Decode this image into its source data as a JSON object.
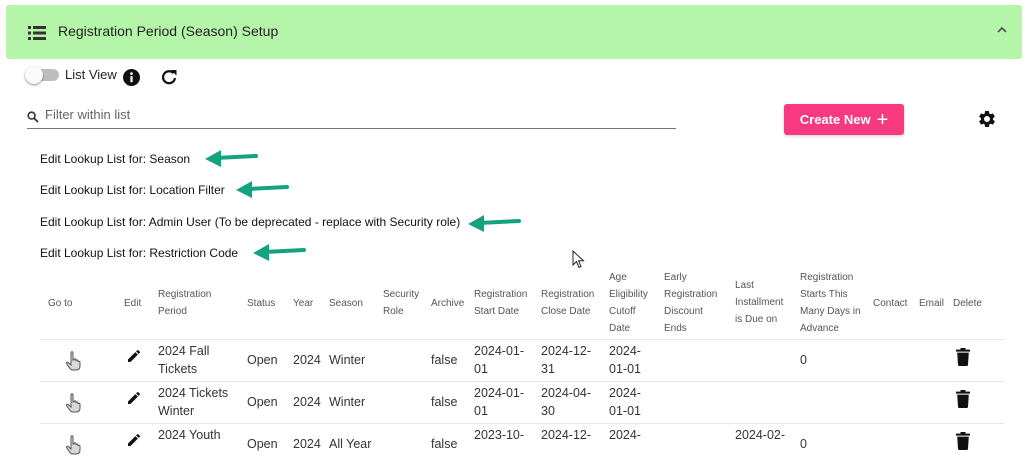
{
  "header": {
    "title": "Registration Period (Season) Setup"
  },
  "toolbar": {
    "list_view_label": "List View"
  },
  "filter": {
    "placeholder": "Filter within list"
  },
  "create_button": {
    "label": "Create New"
  },
  "lookups": [
    "Edit Lookup List for: Season",
    "Edit Lookup List for: Location Filter",
    "Edit Lookup List for: Admin User (To be deprecated - replace with Security role)",
    "Edit Lookup List for: Restriction Code"
  ],
  "colors": {
    "header_bg": "#b5f5a9",
    "create_button": "#f7397f",
    "arrow": "#14a37f"
  },
  "table": {
    "columns": [
      "Go to",
      "Edit",
      "Registration Period",
      "Status",
      "Year",
      "Season",
      "Security Role",
      "Archive",
      "Registration Start Date",
      "Registration Close Date",
      "Age Eligibility Cutoff Date",
      "Early Registration Discount Ends",
      "Last Installment is Due on",
      "Registration Starts This Many Days in Advance",
      "Contact",
      "Email",
      "Delete"
    ],
    "rows": [
      {
        "period": "2024 Fall Tickets",
        "status": "Open",
        "year": "2024",
        "season": "Winter",
        "archive": "false",
        "start": "2024-01-01",
        "close": "2024-12-31",
        "cutoff": "2024-01-01",
        "installment": "",
        "days": "0"
      },
      {
        "period": "2024 Tickets Winter",
        "status": "Open",
        "year": "2024",
        "season": "Winter",
        "archive": "false",
        "start": "2024-01-01",
        "close": "2024-04-30",
        "cutoff": "2024-01-01",
        "installment": "",
        "days": ""
      },
      {
        "period": "2024 Youth",
        "status": "Open",
        "year": "2024",
        "season": "All Year",
        "archive": "false",
        "start": "2023-10-",
        "close": "2024-12-",
        "cutoff": "2024-",
        "installment": "2024-02-",
        "days": "0"
      }
    ]
  },
  "icons": {
    "header": "list-icon",
    "collapse": "chevron-up-icon",
    "info": "info-icon",
    "refresh": "refresh-icon",
    "search": "search-icon",
    "settings": "gear-icon",
    "goto": "pointer-hand-icon",
    "edit": "pencil-icon",
    "delete": "trash-icon"
  }
}
